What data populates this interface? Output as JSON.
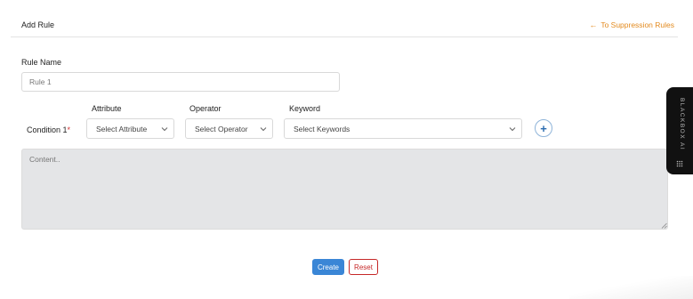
{
  "header": {
    "title": "Add Rule",
    "back_link_label": "To Suppression Rules"
  },
  "rule_name": {
    "label": "Rule Name",
    "value": "Rule 1"
  },
  "condition": {
    "label": "Condition 1",
    "required_mark": "*",
    "columns": {
      "attribute": "Attribute",
      "operator": "Operator",
      "keyword": "Keyword"
    },
    "attribute_select": "Select Attribute",
    "operator_select": "Select Operator",
    "keyword_select": "Select Keywords",
    "add_icon": "plus-icon"
  },
  "content": {
    "placeholder": "Content.."
  },
  "buttons": {
    "create": "Create",
    "reset": "Reset"
  },
  "side_tab": {
    "label": "BLACKBOX AI"
  },
  "colors": {
    "accent_orange": "#e38a1e",
    "primary_blue": "#3a86d6",
    "danger_red": "#c62828"
  }
}
